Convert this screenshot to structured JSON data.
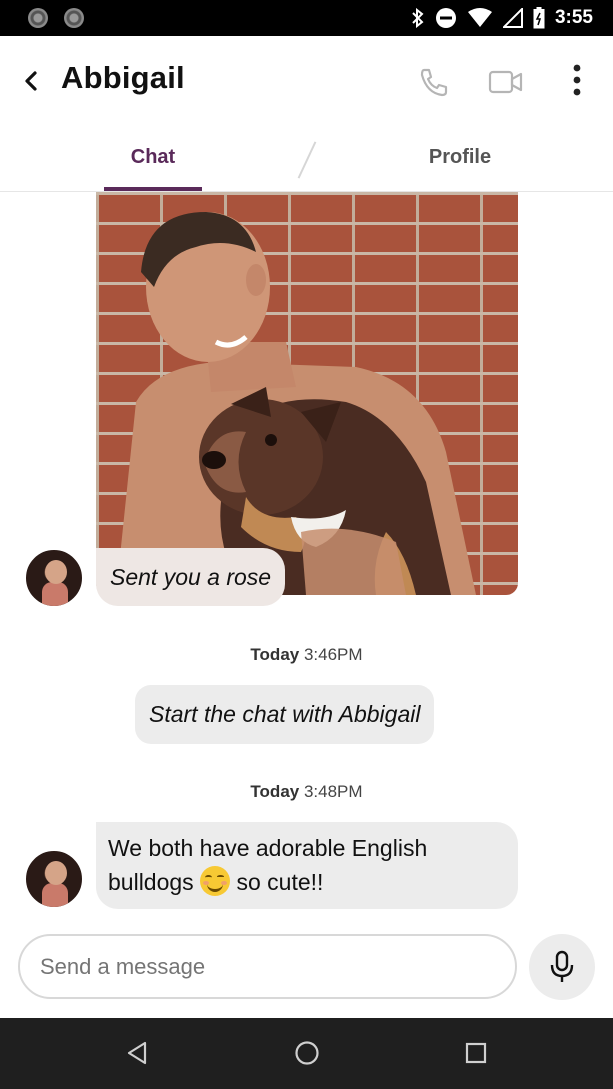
{
  "status_bar": {
    "time": "3:55"
  },
  "header": {
    "back_icon": "arrow-back-icon",
    "title": "Abbigail",
    "actions": [
      "phone-icon",
      "video-camera-icon",
      "more-vertical-icon"
    ]
  },
  "tabs": [
    {
      "label": "Chat",
      "active": true
    },
    {
      "label": "Profile",
      "active": false
    }
  ],
  "chat": {
    "rose_message": "Sent you a rose",
    "stamp1": {
      "day": "Today",
      "time": "3:46PM"
    },
    "system_message": "Start the chat with Abbigail",
    "stamp2": {
      "day": "Today",
      "time": "3:48PM"
    },
    "message": {
      "text_before": "We both have adorable English bulldogs",
      "emoji": "smiling-face-icon",
      "text_after": "so cute!!"
    }
  },
  "composer": {
    "placeholder": "Send a message",
    "mic_icon": "microphone-icon"
  },
  "nav_bar": [
    "back-triangle-icon",
    "home-circle-icon",
    "recents-square-icon"
  ],
  "colors": {
    "accent": "#5a2a5a",
    "bubble": "#ececec",
    "rose_bubble": "#eee7e4"
  }
}
